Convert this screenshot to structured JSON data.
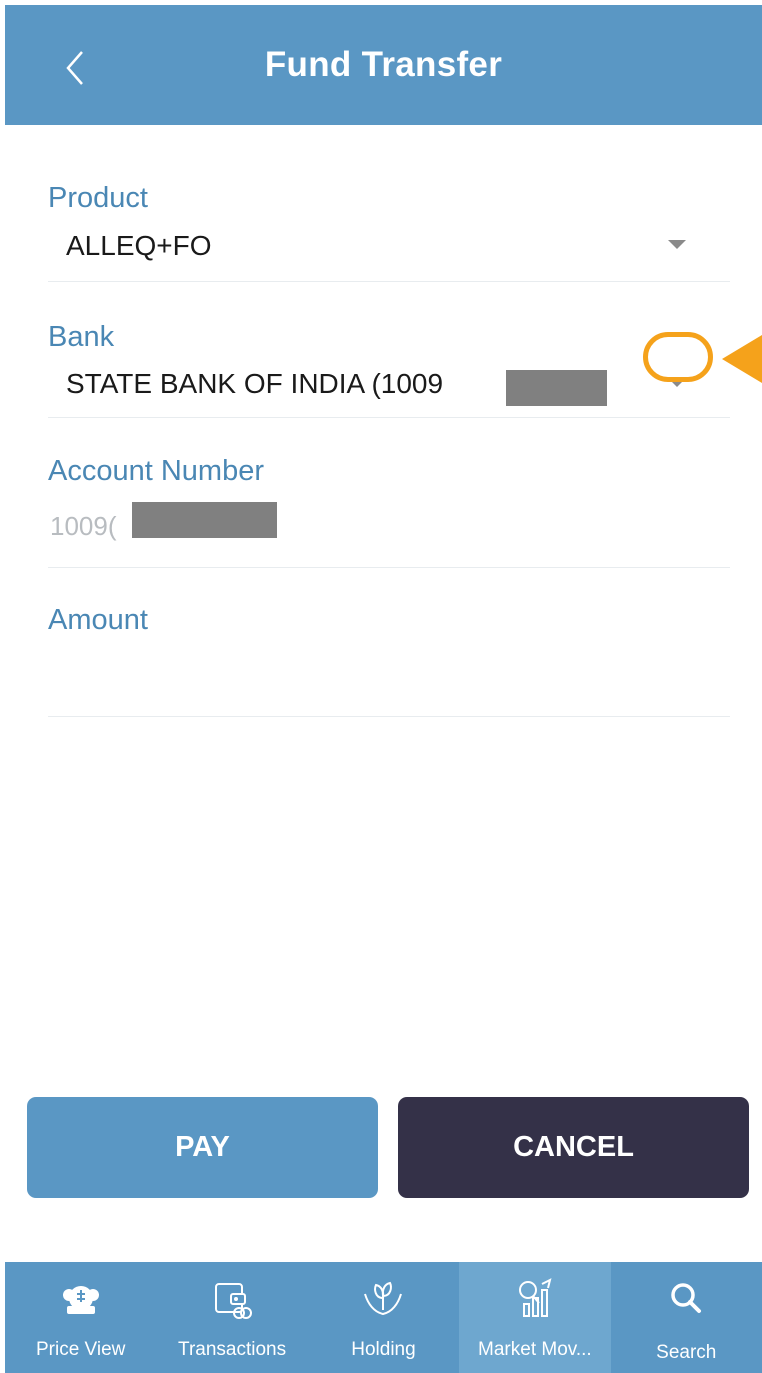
{
  "header": {
    "title": "Fund Transfer"
  },
  "form": {
    "product": {
      "label": "Product",
      "value": "ALLEQ+FO"
    },
    "bank": {
      "label": "Bank",
      "value": "STATE BANK OF INDIA (1009"
    },
    "account": {
      "label": "Account Number",
      "value": "1009("
    },
    "amount": {
      "label": "Amount",
      "value": ""
    }
  },
  "buttons": {
    "pay_label": "PAY",
    "cancel_label": "CANCEL"
  },
  "nav": {
    "items": [
      {
        "label": "Price View",
        "icon": "price-view-icon"
      },
      {
        "label": "Transactions",
        "icon": "wallet-icon"
      },
      {
        "label": "Holding",
        "icon": "plant-hands-icon"
      },
      {
        "label": "Market Mov...",
        "icon": "market-chart-icon",
        "active": true
      },
      {
        "label": "Search",
        "icon": "search-icon"
      }
    ]
  },
  "colors": {
    "primary": "#5a97c4",
    "dark_button": "#343148",
    "label": "#4a87b4",
    "annotation": "#f5a21b"
  }
}
